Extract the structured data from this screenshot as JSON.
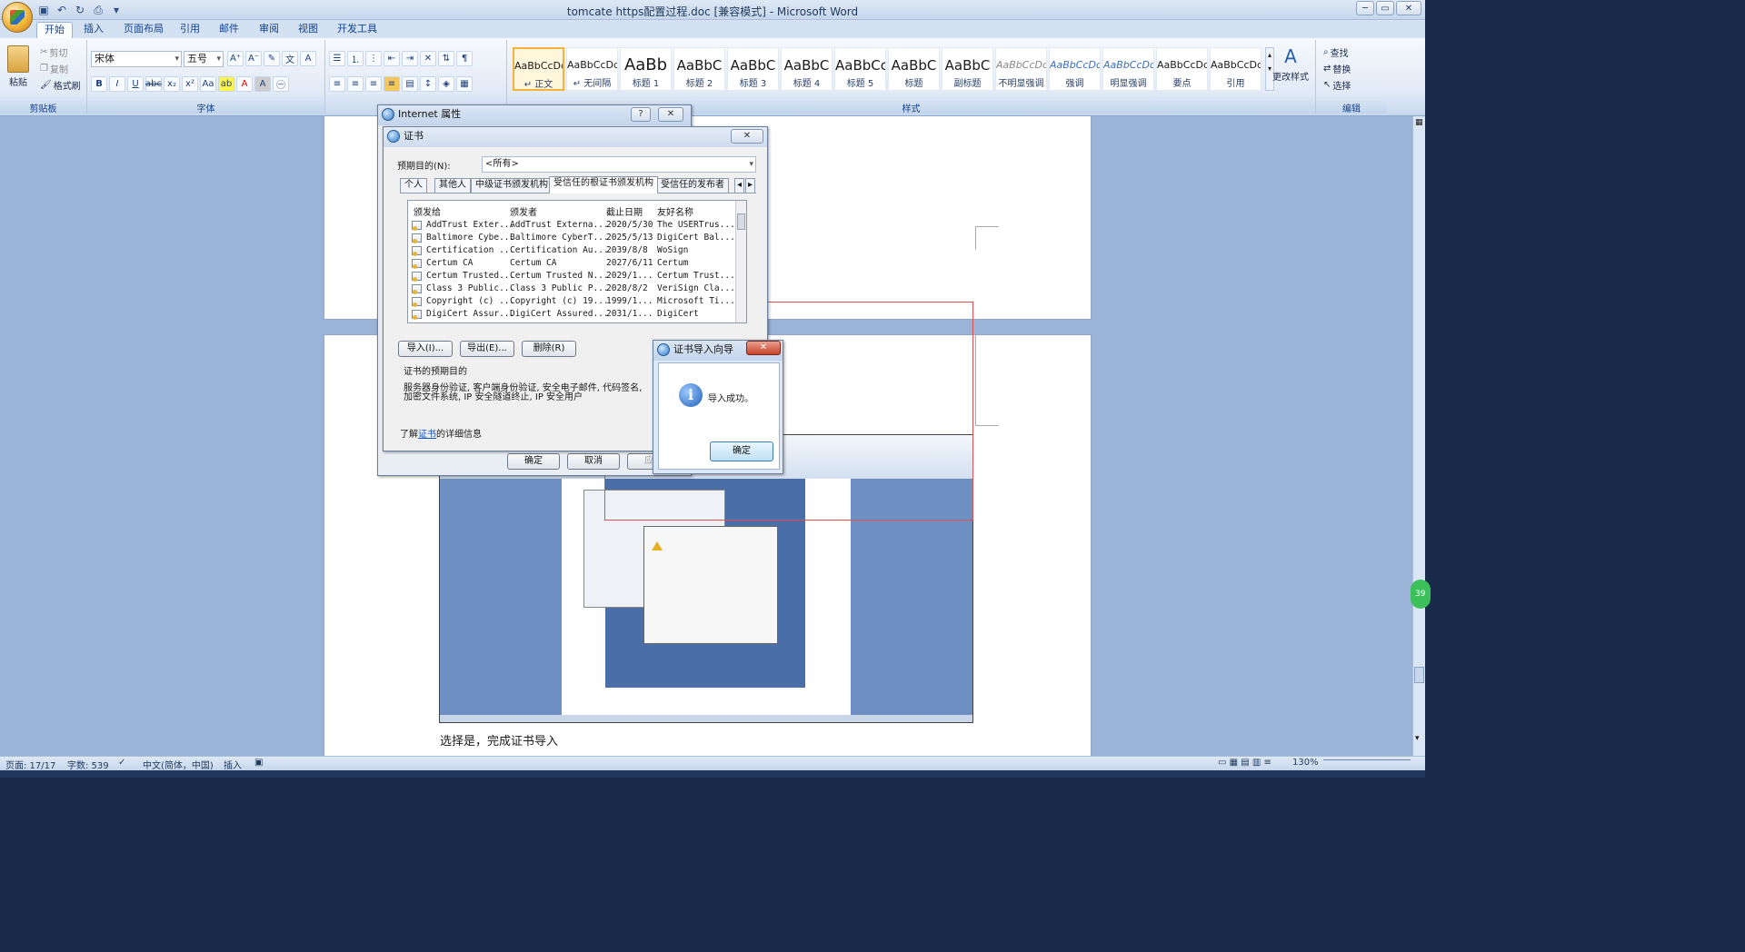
{
  "window": {
    "title": "tomcate https配置过程.doc [兼容模式] - Microsoft Word",
    "min": "─",
    "max": "▭",
    "close": "✕"
  },
  "tabs": [
    "开始",
    "插入",
    "页面布局",
    "引用",
    "邮件",
    "审阅",
    "视图",
    "开发工具"
  ],
  "ribbon": {
    "clipboard": {
      "label": "剪贴板",
      "paste": "粘贴",
      "cut": "剪切",
      "copy": "复制",
      "format_painter": "格式刷"
    },
    "font": {
      "label": "字体",
      "font_name": "宋体",
      "font_size": "五号"
    },
    "paragraph": {
      "label": ""
    },
    "styles": {
      "label": "样式",
      "items": [
        {
          "sample": "AaBbCcDd",
          "name": "↵ 正文"
        },
        {
          "sample": "AaBbCcDd",
          "name": "↵ 无间隔"
        },
        {
          "sample": "AaBb",
          "name": "标题 1"
        },
        {
          "sample": "AaBbC",
          "name": "标题 2"
        },
        {
          "sample": "AaBbC",
          "name": "标题 3"
        },
        {
          "sample": "AaBbC",
          "name": "标题 4"
        },
        {
          "sample": "AaBbCc",
          "name": "标题 5"
        },
        {
          "sample": "AaBbC",
          "name": "标题"
        },
        {
          "sample": "AaBbC",
          "name": "副标题"
        },
        {
          "sample": "AaBbCcDd",
          "name": "不明显强调"
        },
        {
          "sample": "AaBbCcDd",
          "name": "强调"
        },
        {
          "sample": "AaBbCcDd",
          "name": "明显强调"
        },
        {
          "sample": "AaBbCcDd",
          "name": "要点"
        },
        {
          "sample": "AaBbCcDd",
          "name": "引用"
        }
      ],
      "change_styles": "更改样式"
    },
    "editing": {
      "label": "编辑",
      "find": "查找",
      "replace": "替换",
      "select": "选择"
    }
  },
  "document": {
    "caption": "选择是，完成证书导入"
  },
  "internet_props": {
    "title": "Internet 属性",
    "help": "?",
    "close": "✕"
  },
  "cert_dialog": {
    "title": "证书",
    "purpose_label": "预期目的(N):",
    "purpose_value": "<所有>",
    "tabs": [
      "个人",
      "其他人",
      "中级证书颁发机构",
      "受信任的根证书颁发机构",
      "受信任的发布者"
    ],
    "columns": [
      "颁发给",
      "颁发者",
      "截止日期",
      "友好名称"
    ],
    "rows": [
      [
        "AddTrust Exter...",
        "AddTrust Externa...",
        "2020/5/30",
        "The USERTrus..."
      ],
      [
        "Baltimore Cybe...",
        "Baltimore CyberT...",
        "2025/5/13",
        "DigiCert Bal..."
      ],
      [
        "Certification ...",
        "Certification Au...",
        "2039/8/8",
        "WoSign"
      ],
      [
        "Certum CA",
        "Certum CA",
        "2027/6/11",
        "Certum"
      ],
      [
        "Certum Trusted...",
        "Certum Trusted N...",
        "2029/1...",
        "Certum Trust..."
      ],
      [
        "Class 3 Public...",
        "Class 3 Public P...",
        "2028/8/2",
        "VeriSign Cla..."
      ],
      [
        "Copyright (c) ...",
        "Copyright (c) 19...",
        "1999/1...",
        "Microsoft Ti..."
      ],
      [
        "DigiCert Assur...",
        "DigiCert Assured...",
        "2031/1...",
        "DigiCert"
      ]
    ],
    "import": "导入(I)...",
    "export": "导出(E)...",
    "remove": "删除(R)",
    "purposes_title": "证书的预期目的",
    "purposes_text_1": "服务器身份验证, 客户端身份验证, 安全电子邮件, 代码签名,",
    "purposes_text_2": "加密文件系统, IP 安全隧道终止, IP 安全用户",
    "learn_prefix": "了解",
    "learn_link": "证书",
    "learn_suffix": "的详细信息",
    "ok": "确定",
    "cancel": "取消",
    "apply": "应用"
  },
  "wizard": {
    "title": "证书导入向导",
    "message": "导入成功。",
    "ok": "确定"
  },
  "statusbar": {
    "page": "页面: 17/17",
    "words": "字数: 539",
    "lang": "中文(简体，中国)",
    "mode": "插入",
    "zoom": "130%"
  },
  "side_badge": "39",
  "colors": {
    "accent": "#15428b",
    "ribbon": "#dfe9f5",
    "doc_bg": "#9bb3d6",
    "highlight_box": "#e05050"
  }
}
